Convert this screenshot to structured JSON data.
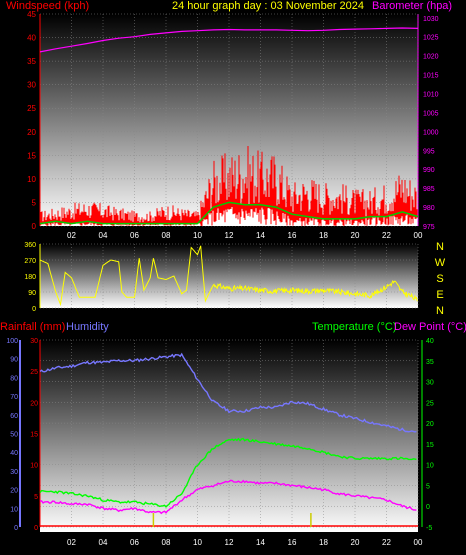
{
  "header": {
    "windspeed_label": "Windspeed (kph)",
    "title": "24 hour graph day : 03 November 2024",
    "barometer_label": "Barometer (hpa)"
  },
  "lower_header": {
    "rainfall_label": "Rainfall (mm)",
    "humidity_label": "Humidity",
    "temperature_label": "Temperature (°C)",
    "dewpoint_label": "Dew Point (°C)"
  },
  "colors": {
    "windspeed": "#ff0000",
    "gust_fill": "#ff0000",
    "average_wind": "#00cc00",
    "wind_white": "#ffffff",
    "barometer": "#ff00ff",
    "direction": "#ffff00",
    "rainfall": "#ff0000",
    "humidity": "#7777ff",
    "temperature": "#00ff00",
    "dewpoint": "#ff00ff",
    "rain_ticks": "#cccc00",
    "title": "#ffff00"
  },
  "chart_data": [
    {
      "type": "line",
      "panel": "wind-barometer",
      "x_tick_labels": [
        "02",
        "04",
        "06",
        "08",
        "10",
        "12",
        "14",
        "16",
        "18",
        "20",
        "22",
        "00"
      ],
      "x_hours": [
        0,
        1,
        2,
        3,
        4,
        5,
        6,
        7,
        8,
        9,
        10,
        11,
        12,
        13,
        14,
        15,
        16,
        17,
        18,
        19,
        20,
        21,
        22,
        23,
        24
      ],
      "left_axis": {
        "label": "Windspeed (kph)",
        "ticks": [
          0,
          5,
          10,
          15,
          20,
          25,
          30,
          35,
          40,
          45
        ],
        "ylim": [
          0,
          45
        ]
      },
      "right_axis": {
        "label": "Barometer (hpa)",
        "ticks": [
          975,
          980,
          985,
          990,
          995,
          1000,
          1005,
          1010,
          1015,
          1020,
          1025,
          1030
        ],
        "ylim": [
          975,
          1031
        ]
      },
      "series": [
        {
          "name": "Barometer",
          "axis": "right",
          "values": [
            1021,
            1021.8,
            1022.5,
            1023.2,
            1024,
            1024.6,
            1025,
            1025.6,
            1026,
            1026.4,
            1026.6,
            1026.8,
            1026.9,
            1026.8,
            1026.8,
            1026.8,
            1026.7,
            1026.6,
            1026.7,
            1026.9,
            1027,
            1027.1,
            1027.2,
            1027.3,
            1027.2
          ]
        },
        {
          "name": "Gust",
          "axis": "left",
          "values": [
            2,
            2.5,
            3,
            3.5,
            3,
            2.5,
            2,
            2,
            3,
            2.5,
            2,
            9,
            10,
            11,
            10,
            10,
            6,
            7,
            6,
            6,
            5,
            5,
            6,
            8,
            6
          ]
        },
        {
          "name": "Average",
          "axis": "left",
          "values": [
            0.5,
            1,
            0.5,
            1,
            0.5,
            0.5,
            0.5,
            0.5,
            0.5,
            0.5,
            0.5,
            4,
            5,
            4.5,
            4.5,
            4,
            2.5,
            2,
            1.5,
            1.5,
            1.5,
            2,
            2,
            3,
            2
          ]
        },
        {
          "name": "Wind",
          "axis": "left",
          "values": [
            0.3,
            0.5,
            0.3,
            0.5,
            0.3,
            0.3,
            0.3,
            0.3,
            0.3,
            0.3,
            0.3,
            2,
            2.5,
            2.5,
            2.5,
            2,
            1,
            1,
            0.8,
            0.8,
            0.8,
            1,
            1.2,
            1.5,
            1
          ]
        }
      ]
    },
    {
      "type": "line",
      "panel": "wind-direction",
      "x_tick_labels": [
        "02",
        "04",
        "06",
        "08",
        "10",
        "12",
        "14",
        "16",
        "18",
        "20",
        "22",
        "00"
      ],
      "left_axis": {
        "ticks": [
          0,
          90,
          180,
          270,
          360
        ],
        "ylim": [
          0,
          360
        ]
      },
      "right_axis": {
        "ticks": [
          "N",
          "W",
          "S",
          "E",
          "N"
        ]
      },
      "series": [
        {
          "name": "Direction",
          "x": [
            0,
            0.5,
            1,
            1.3,
            1.6,
            2,
            2.5,
            3,
            3.5,
            4,
            4.5,
            5,
            5.2,
            5.5,
            6,
            6.3,
            6.6,
            7,
            7.2,
            7.5,
            8,
            8.5,
            9,
            9.3,
            9.6,
            10,
            10.2,
            10.5,
            11,
            12,
            13,
            14,
            15,
            16,
            17,
            18,
            19,
            20,
            21,
            22,
            22.5,
            23,
            23.5,
            24
          ],
          "values": [
            270,
            250,
            90,
            20,
            200,
            170,
            60,
            60,
            60,
            240,
            270,
            260,
            90,
            60,
            60,
            280,
            100,
            170,
            280,
            170,
            160,
            180,
            80,
            100,
            340,
            300,
            350,
            40,
            130,
            110,
            110,
            100,
            95,
            100,
            95,
            100,
            90,
            80,
            70,
            120,
            150,
            90,
            70,
            40
          ]
        }
      ]
    },
    {
      "type": "line",
      "panel": "temperature-humidity-rain",
      "x_tick_labels": [
        "02",
        "04",
        "06",
        "08",
        "10",
        "12",
        "14",
        "16",
        "18",
        "20",
        "22",
        "00"
      ],
      "humidity_axis": {
        "ticks": [
          0,
          10,
          20,
          30,
          40,
          50,
          60,
          70,
          80,
          90,
          100
        ],
        "ylim": [
          0,
          100
        ]
      },
      "rain_axis": {
        "ticks": [
          0,
          5,
          10,
          15,
          20,
          25,
          30
        ],
        "ylim": [
          0,
          30
        ]
      },
      "temperature_axis": {
        "ticks": [
          -5,
          0,
          5,
          10,
          15,
          20,
          25,
          30,
          35,
          40
        ],
        "ylim": [
          -5,
          40
        ]
      },
      "x_hours": [
        0,
        1,
        2,
        3,
        4,
        5,
        6,
        7,
        8,
        9,
        10,
        11,
        12,
        13,
        14,
        15,
        16,
        17,
        18,
        19,
        20,
        21,
        22,
        23,
        24
      ],
      "series": [
        {
          "name": "Humidity",
          "axis": "humidity",
          "values": [
            83,
            85,
            86,
            88,
            88,
            89,
            89,
            90,
            91,
            92,
            79,
            67,
            62,
            62,
            64,
            64,
            67,
            66,
            63,
            60,
            58,
            56,
            54,
            52,
            51
          ]
        },
        {
          "name": "Temperature",
          "axis": "temperature",
          "values": [
            3.5,
            3.5,
            3,
            2.5,
            1.5,
            1,
            1,
            0.5,
            0,
            3,
            10,
            14,
            16,
            16,
            15.5,
            15,
            14.5,
            14,
            13,
            12,
            11.5,
            11.5,
            11.5,
            11.5,
            11
          ]
        },
        {
          "name": "Dew Point",
          "axis": "temperature",
          "values": [
            1,
            1,
            0.5,
            0.5,
            -0.5,
            -1,
            -0.5,
            -1.5,
            -1.5,
            1.5,
            4,
            5,
            6,
            6,
            5.5,
            5.5,
            5,
            4.5,
            4,
            3,
            2.5,
            2,
            1.5,
            0,
            -1
          ]
        },
        {
          "name": "Rainfall",
          "axis": "rain",
          "values": [
            0,
            0,
            0,
            0,
            0,
            0,
            0,
            0,
            0,
            0,
            0,
            0,
            0,
            0,
            0,
            0,
            0,
            0,
            0,
            0,
            0,
            0,
            0,
            0,
            0
          ]
        }
      ],
      "rain_tick_hours": [
        7.2,
        17.2
      ]
    }
  ]
}
